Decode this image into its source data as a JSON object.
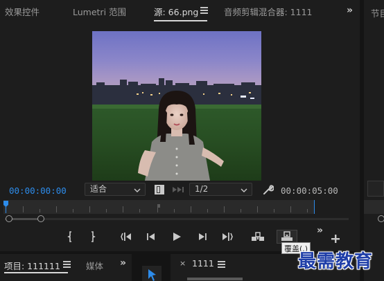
{
  "tabs": {
    "effects": "效果控件",
    "lumetri": "Lumetri 范围",
    "source": "源: 66.png",
    "audio_mixer": "音频剪辑混合器: 1111",
    "program_partial": "节目"
  },
  "monitor": {
    "timecode_current": "00:00:00:00",
    "fit_select": "适合",
    "resolution_select": "1/2",
    "timecode_duration": "00:00:05:00"
  },
  "transport": {
    "tooltip": "覆盖(.)"
  },
  "bottom": {
    "project_tab": "项目: 111111",
    "media_tab_partial": "媒体",
    "sequence_tab": "1111",
    "close_glyph": "×"
  },
  "watermark": "最需教育",
  "colors": {
    "timecode_blue": "#2d8ceb",
    "playhead_blue": "#2d8ceb",
    "panel_bg": "#1d1d1d",
    "divider": "#141414"
  },
  "icons": [
    "menu-icon",
    "double-chevron-icon",
    "wrench-icon",
    "mark-in-icon",
    "mark-out-icon",
    "go-to-in-icon",
    "step-back-icon",
    "play-icon",
    "step-forward-icon",
    "go-to-out-icon",
    "insert-icon",
    "overwrite-icon",
    "add-icon",
    "selection-tool-icon"
  ]
}
